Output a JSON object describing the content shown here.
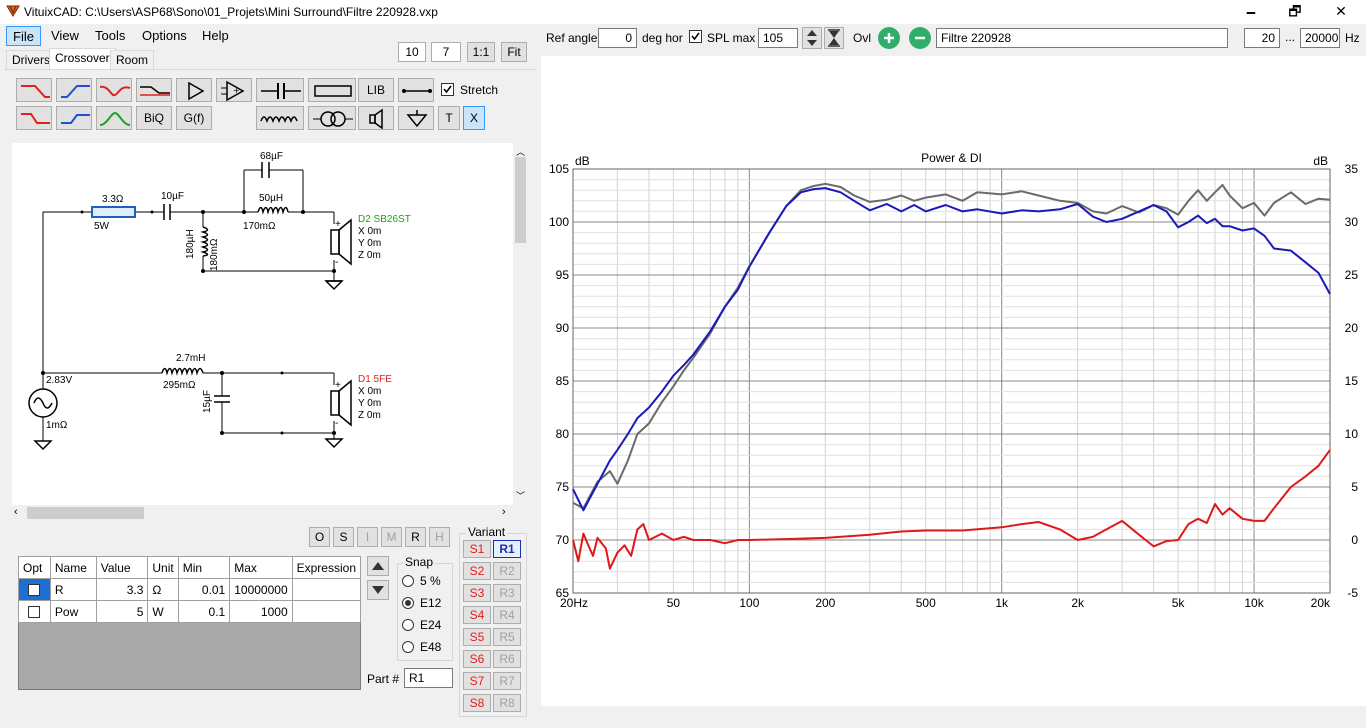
{
  "window": {
    "title": "VituixCAD: C:\\Users\\ASP68\\Sono\\01_Projets\\Mini Surround\\Filtre 220928.vxp",
    "minimize": "🗕",
    "restore": "🗗",
    "close": "✕"
  },
  "menu": [
    "File",
    "View",
    "Tools",
    "Options",
    "Help"
  ],
  "zoom": {
    "w": "10",
    "h": "7",
    "one": "1:1",
    "fit": "Fit"
  },
  "tabs": [
    "Drivers",
    "Crossover",
    "Room"
  ],
  "tools": {
    "lib": "LIB",
    "biq": "BiQ",
    "gf": "G(f)",
    "t": "T",
    "x": "X",
    "stretch": "Stretch"
  },
  "schematic": {
    "r1_value": "3.3Ω",
    "r1_power": "5W",
    "c1": "10µF",
    "c_top": "68µF",
    "l_top": "50µH",
    "l_top_r": "170mΩ",
    "l_shunt": "180µH",
    "l_shunt_r": "180mΩ",
    "d2_name": "D2 SB26ST",
    "d2_x": "X 0m",
    "d2_y": "Y 0m",
    "d2_z": "Z 0m",
    "l2": "2.7mH",
    "l2_r": "295mΩ",
    "c2": "15µF",
    "d1_name": "D1 5FE",
    "d1_x": "X 0m",
    "d1_y": "Y 0m",
    "d1_z": "Z 0m",
    "source_v": "2.83V",
    "source_r": "1mΩ",
    "plus": "+",
    "minus": "-"
  },
  "part_buttons": [
    "O",
    "S",
    "I",
    "M",
    "R",
    "H"
  ],
  "props": {
    "headers": [
      "Opt",
      "Name",
      "Value",
      "Unit",
      "Min",
      "Max",
      "Expression"
    ],
    "rows": [
      {
        "name": "R",
        "value": "3.3",
        "unit": "Ω",
        "min": "0.01",
        "max": "10000000",
        "expr": ""
      },
      {
        "name": "Pow",
        "value": "5",
        "unit": "W",
        "min": "0.1",
        "max": "1000",
        "expr": ""
      }
    ]
  },
  "snap": {
    "label": "Snap",
    "options": [
      "5 %",
      "E12",
      "E24",
      "E48"
    ],
    "selected": "E12"
  },
  "part_number": {
    "label": "Part #",
    "value": "R1"
  },
  "variant": {
    "label": "Variant",
    "s": [
      "S1",
      "S2",
      "S3",
      "S4",
      "S5",
      "S6",
      "S7",
      "S8"
    ],
    "r": [
      "R1",
      "R2",
      "R3",
      "R4",
      "R5",
      "R6",
      "R7",
      "R8"
    ],
    "selected": "R1"
  },
  "toolbar_right": {
    "ref_angle_label": "Ref angle",
    "ref_angle": "0",
    "deg_hor": "deg hor",
    "spl_max_label": "SPL max",
    "spl_max": "105",
    "ovl": "Ovl",
    "filename": "Filtre 220928",
    "f_min": "20",
    "dots": "...",
    "f_max": "20000",
    "hz": "Hz"
  },
  "chart_data": {
    "type": "line",
    "title": "Power & DI",
    "ylabel_left": "dB",
    "ylabel_right": "dB",
    "x_scale": "log",
    "xlim": [
      20,
      20000
    ],
    "ylim_left": [
      65,
      105
    ],
    "ylim_right": [
      -5,
      35
    ],
    "x_ticks": [
      20,
      50,
      100,
      200,
      500,
      1000,
      2000,
      5000,
      10000,
      20000
    ],
    "x_tick_labels": [
      "20Hz",
      "50",
      "100",
      "200",
      "500",
      "1k",
      "2k",
      "5k",
      "10k",
      "20k"
    ],
    "y_ticks_left": [
      65,
      70,
      75,
      80,
      85,
      90,
      95,
      100,
      105
    ],
    "y_ticks_right": [
      -5,
      0,
      5,
      10,
      15,
      20,
      25,
      30,
      35
    ],
    "grid": true,
    "series": [
      {
        "color": "#6a6a6a",
        "axis": "left",
        "x": [
          20,
          22,
          25,
          28,
          30,
          33,
          36,
          40,
          45,
          50,
          55,
          60,
          70,
          80,
          90,
          100,
          120,
          140,
          160,
          180,
          200,
          230,
          260,
          300,
          350,
          400,
          450,
          500,
          600,
          700,
          800,
          1000,
          1200,
          1400,
          1700,
          2000,
          2300,
          2600,
          3000,
          3500,
          4000,
          4500,
          5000,
          5500,
          6000,
          6500,
          7000,
          7500,
          8000,
          9000,
          10000,
          11000,
          12000,
          14000,
          16000,
          18000,
          20000
        ],
        "y": [
          73.5,
          73.0,
          75.5,
          76.5,
          75.3,
          77.5,
          80.0,
          81.0,
          83.0,
          84.5,
          86.0,
          87.2,
          89.5,
          92.0,
          93.8,
          95.8,
          99.0,
          101.5,
          103.0,
          103.4,
          103.6,
          103.3,
          102.5,
          101.9,
          102.1,
          102.5,
          102.0,
          102.3,
          102.6,
          102.0,
          102.8,
          102.6,
          102.9,
          102.5,
          102.0,
          101.8,
          101.0,
          100.8,
          101.5,
          100.9,
          101.6,
          101.3,
          100.7,
          102.0,
          103.0,
          102.0,
          102.8,
          103.5,
          102.5,
          101.3,
          101.8,
          100.6,
          101.8,
          102.8,
          101.7,
          102.2,
          102.1
        ]
      },
      {
        "color": "#1a1ab8",
        "axis": "left",
        "x": [
          20,
          22,
          25,
          28,
          30,
          33,
          36,
          40,
          45,
          50,
          55,
          60,
          70,
          80,
          90,
          100,
          120,
          140,
          160,
          180,
          200,
          230,
          260,
          300,
          350,
          400,
          450,
          500,
          600,
          700,
          800,
          1000,
          1200,
          1400,
          1700,
          2000,
          2300,
          2600,
          3000,
          3500,
          4000,
          4500,
          5000,
          5500,
          6000,
          6500,
          7000,
          7500,
          8000,
          9000,
          10000,
          11000,
          12000,
          14000,
          16000,
          18000,
          20000
        ],
        "y": [
          74.8,
          72.8,
          75.3,
          77.5,
          78.5,
          80.0,
          81.5,
          82.5,
          84.0,
          85.5,
          86.5,
          87.5,
          89.7,
          92.0,
          93.6,
          95.8,
          99.0,
          101.5,
          102.8,
          103.1,
          103.2,
          102.8,
          102.0,
          101.1,
          101.7,
          101.0,
          101.6,
          101.0,
          101.6,
          101.0,
          101.2,
          100.8,
          101.1,
          101.0,
          101.2,
          101.7,
          100.5,
          100.0,
          100.3,
          101.0,
          101.6,
          101.0,
          99.5,
          100.0,
          100.6,
          99.9,
          100.3,
          99.6,
          99.6,
          99.2,
          99.4,
          98.7,
          97.5,
          97.3,
          96.2,
          95.2,
          93.2
        ]
      },
      {
        "color": "#e01818",
        "axis": "right",
        "x": [
          20,
          21,
          22,
          23,
          24,
          25,
          27,
          28,
          30,
          32,
          34,
          36,
          38,
          40,
          45,
          50,
          55,
          60,
          70,
          80,
          90,
          100,
          150,
          200,
          300,
          400,
          500,
          700,
          1000,
          1200,
          1400,
          1700,
          2000,
          2300,
          2600,
          3000,
          3500,
          4000,
          4500,
          5000,
          5500,
          6000,
          6500,
          7000,
          7500,
          8000,
          9000,
          10000,
          11000,
          12000,
          14000,
          16000,
          18000,
          20000
        ],
        "y": [
          0.0,
          -2.0,
          0.6,
          -0.5,
          -1.5,
          0.2,
          -0.8,
          -2.7,
          -1.2,
          -0.5,
          -1.5,
          1.0,
          1.5,
          0.0,
          0.6,
          0.0,
          0.3,
          0.0,
          0.0,
          -0.3,
          0.0,
          0.0,
          0.1,
          0.2,
          0.5,
          0.8,
          0.9,
          0.9,
          1.2,
          1.5,
          1.7,
          1.0,
          0.0,
          0.3,
          1.0,
          1.8,
          0.5,
          -0.6,
          -0.1,
          0.0,
          1.5,
          2.0,
          1.6,
          3.4,
          2.4,
          3.0,
          2.0,
          1.8,
          1.8,
          3.0,
          5.0,
          6.0,
          7.0,
          8.5
        ]
      }
    ]
  }
}
